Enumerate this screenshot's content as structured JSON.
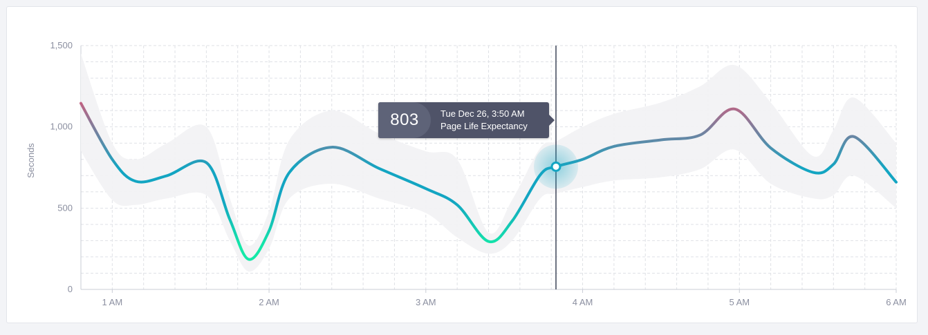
{
  "chart_data": {
    "type": "line",
    "title": "",
    "xlabel": "",
    "ylabel": "Seconds",
    "ylim": [
      0,
      1500
    ],
    "y_ticks": [
      0,
      500,
      1000,
      1500
    ],
    "y_tick_labels": [
      "0",
      "500",
      "1,000",
      "1,500"
    ],
    "x_ticks": [
      1,
      2,
      3,
      4,
      5,
      6
    ],
    "x_tick_labels": [
      "1 AM",
      "2 AM",
      "3 AM",
      "4 AM",
      "5 AM",
      "6 AM"
    ],
    "xlim": [
      0.8,
      6.0
    ],
    "grid": true,
    "series": [
      {
        "name": "Page Life Expectancy",
        "x": [
          0.8,
          1.0,
          1.15,
          1.35,
          1.6,
          1.75,
          1.87,
          2.0,
          2.13,
          2.4,
          2.7,
          3.0,
          3.2,
          3.4,
          3.55,
          3.73,
          3.83,
          4.0,
          4.2,
          4.5,
          4.75,
          4.97,
          5.2,
          5.47,
          5.6,
          5.73,
          6.0
        ],
        "values": [
          1145,
          800,
          665,
          700,
          780,
          430,
          185,
          360,
          720,
          875,
          745,
          620,
          520,
          295,
          420,
          705,
          755,
          800,
          880,
          920,
          950,
          1110,
          870,
          720,
          770,
          940,
          660
        ]
      },
      {
        "name": "band_upper",
        "x": [
          0.8,
          1.0,
          1.15,
          1.35,
          1.6,
          1.75,
          1.87,
          2.0,
          2.13,
          2.4,
          2.7,
          3.0,
          3.2,
          3.4,
          3.55,
          3.73,
          3.83,
          4.0,
          4.2,
          4.5,
          4.75,
          4.97,
          5.2,
          5.47,
          5.6,
          5.73,
          6.0
        ],
        "values": [
          1450,
          900,
          800,
          900,
          1000,
          560,
          270,
          480,
          920,
          1100,
          960,
          850,
          800,
          350,
          550,
          870,
          910,
          1000,
          1080,
          1150,
          1250,
          1380,
          1150,
          820,
          980,
          1180,
          900
        ]
      },
      {
        "name": "band_lower",
        "x": [
          0.8,
          1.0,
          1.15,
          1.35,
          1.6,
          1.75,
          1.87,
          2.0,
          2.13,
          2.4,
          2.7,
          3.0,
          3.2,
          3.4,
          3.55,
          3.73,
          3.83,
          4.0,
          4.2,
          4.5,
          4.75,
          4.97,
          5.2,
          5.47,
          5.6,
          5.73,
          6.0
        ],
        "values": [
          850,
          550,
          520,
          560,
          580,
          300,
          110,
          250,
          560,
          650,
          560,
          470,
          320,
          220,
          300,
          560,
          590,
          630,
          670,
          690,
          740,
          860,
          650,
          560,
          580,
          700,
          500
        ]
      }
    ],
    "marker": {
      "x": 3.83,
      "value": 803,
      "date_label": "Tue Dec 26, 3:50 AM",
      "series_label": "Page Life Expectancy"
    },
    "colors": {
      "low": "#14e8a8",
      "mid": "#13a5c2",
      "high": "#d65a7b",
      "band": "#f2f2f4",
      "grid": "#dfe1e6",
      "cursor": "#3d4458"
    }
  }
}
